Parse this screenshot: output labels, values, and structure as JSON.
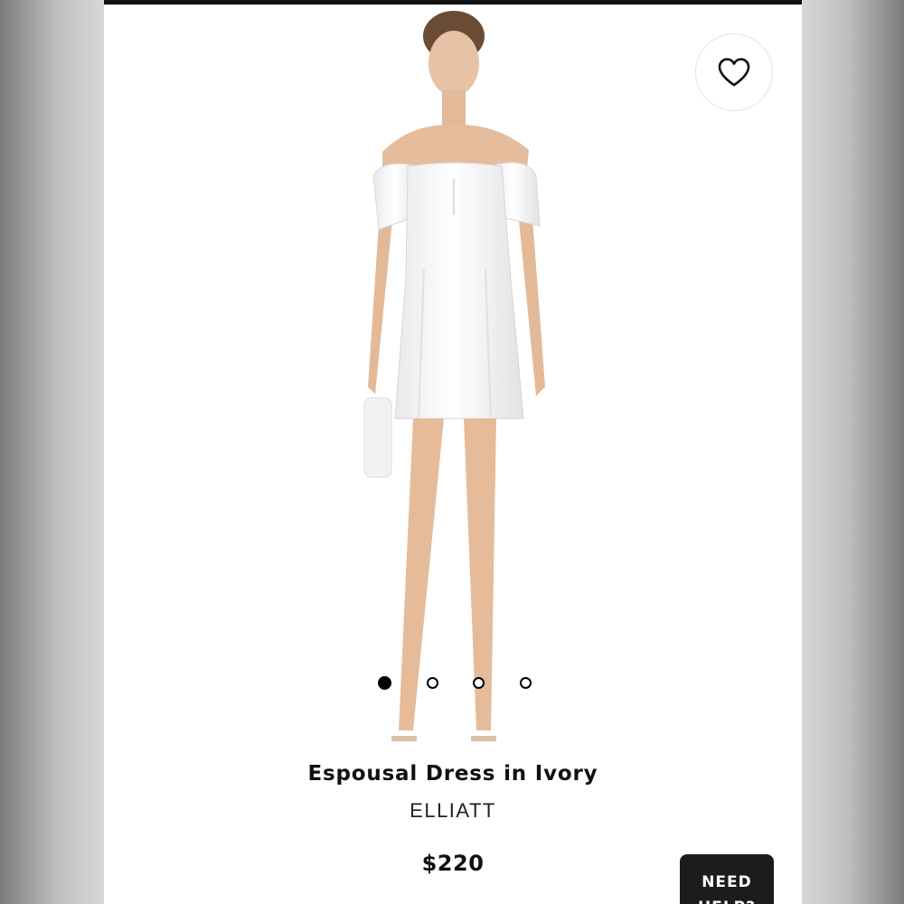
{
  "product": {
    "name": "Espousal Dress in Ivory",
    "brand": "ELLIATT",
    "price": "$220"
  },
  "gallery": {
    "image_count": 4,
    "active_index": 0
  },
  "actions": {
    "favorite_icon": "heart-icon",
    "help_label": "NEED HELP?"
  },
  "colors": {
    "accent": "#000000",
    "help_button_bg": "#1c1c1c"
  }
}
